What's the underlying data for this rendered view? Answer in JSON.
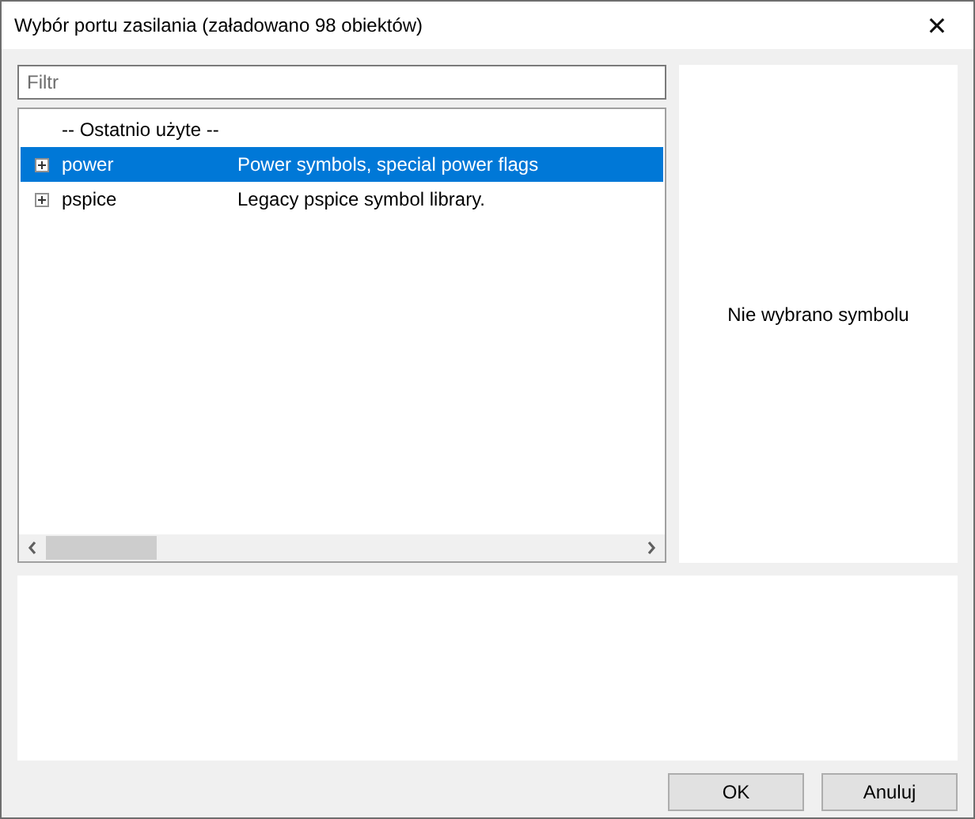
{
  "window": {
    "title": "Wybór portu zasilania (załadowano 98 obiektów)",
    "close": "✕"
  },
  "filter": {
    "placeholder": "Filtr"
  },
  "tree": {
    "items": [
      {
        "kind": "header",
        "name": "-- Ostatnio użyte --",
        "selected": false
      },
      {
        "kind": "library",
        "name": "power",
        "description": "Power symbols, special power flags",
        "expanded": false,
        "selected": true
      },
      {
        "kind": "library",
        "name": "pspice",
        "description": "Legacy pspice symbol library.",
        "expanded": false,
        "selected": false
      }
    ]
  },
  "preview": {
    "message": "Nie wybrano symbolu"
  },
  "buttons": [
    {
      "label": "OK"
    },
    {
      "label": "Anuluj"
    }
  ]
}
